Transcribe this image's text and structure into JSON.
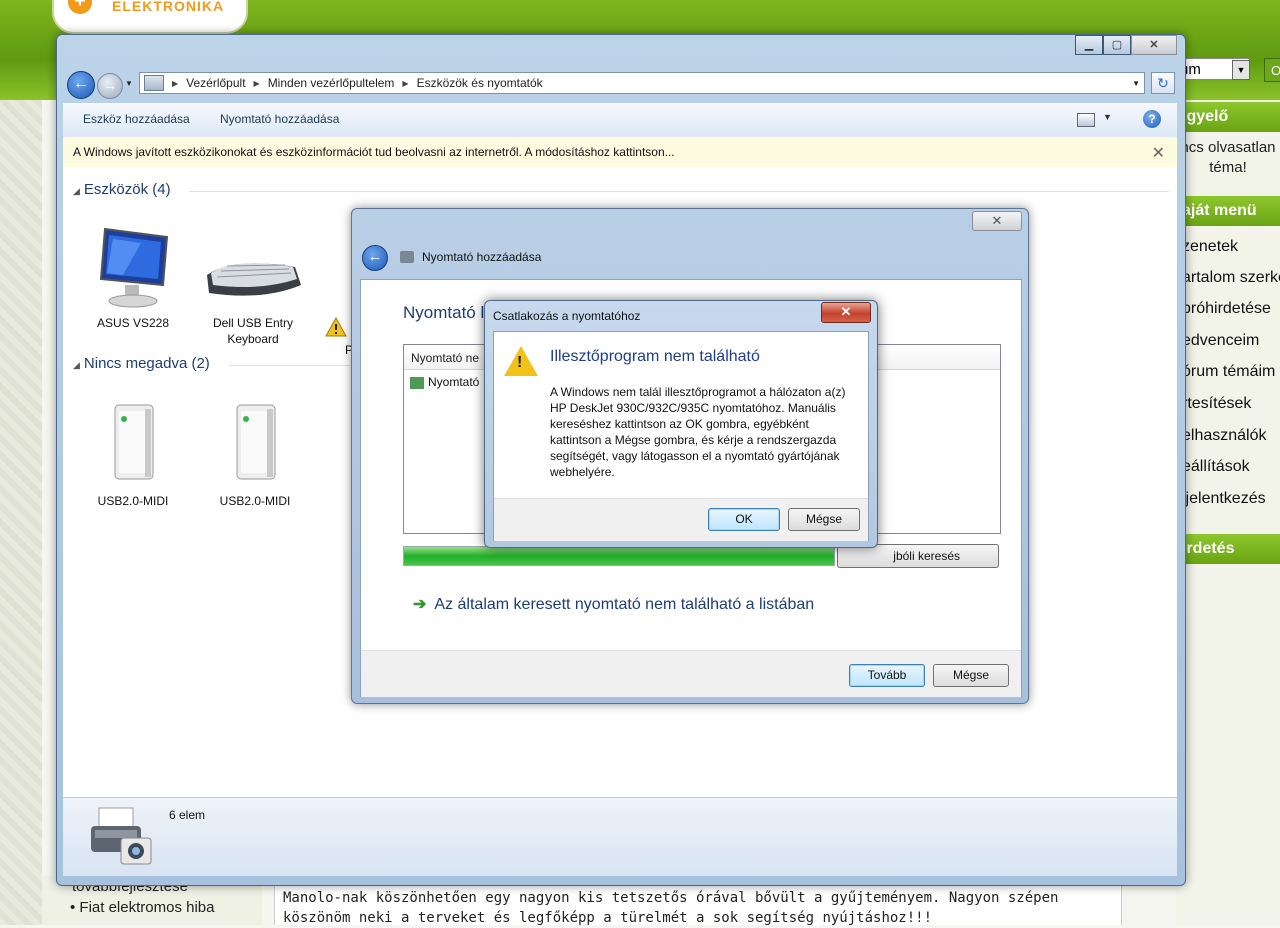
{
  "site": {
    "search_value": "rum",
    "go_label": "O",
    "sidebar": {
      "watch_head": "igyelő",
      "watch_text_1": "ncs olvasatlan",
      "watch_text_2": "téma!",
      "menu_head": "aját menü",
      "menu_items": [
        "zenetek",
        "artalom szerke",
        "próhirdetése",
        "edvenceim",
        "órum témáim",
        "rtesítések",
        "elhasználók",
        "eállítások",
        "ijelentkezés"
      ],
      "ads_head": "irdetés"
    },
    "left_list": {
      "item_1": "továbbfejlesztése",
      "item_2": "• Fiat elektromos hiba"
    },
    "post_text": "Manolo-nak köszönhetően egy nagyon kis tetszetős órával bővült a gyűjteményem. Nagyon szépen\nköszönöm neki a terveket és legfőképp a türelmét a sok segítség nyújtáshoz!!!"
  },
  "explorer": {
    "breadcrumb": [
      "Vezérlőpult",
      "Minden vezérlőpultelem",
      "Eszközök és nyomtatók"
    ],
    "toolbar": {
      "add_device": "Eszköz hozzáadása",
      "add_printer": "Nyomtató hozzáadása"
    },
    "infobar": "A Windows javított eszközikonokat és eszközinformációt tud beolvasni az internetről. A módosításhoz kattintson...",
    "groups": {
      "devices_head": "Eszközök (4)",
      "unspecified_head": "Nincs megadva (2)"
    },
    "devices": [
      {
        "name": "ASUS VS228"
      },
      {
        "name": "Dell USB Entry Keyboard"
      },
      {
        "name": "P"
      }
    ],
    "unspecified": [
      {
        "name": "USB2.0-MIDI"
      },
      {
        "name": "USB2.0-MIDI"
      }
    ],
    "status": "6 elem"
  },
  "wizard": {
    "title": "Nyomtató hozzáadása",
    "heading": "Nyomtató l",
    "list_header": "Nyomtató ne",
    "list_item": "Nyomtató",
    "progress": 1.0,
    "search_again": "jbóli keresés",
    "not_listed_link": "Az általam keresett nyomtató nem található a listában",
    "next": "Tovább",
    "cancel": "Mégse"
  },
  "dialog": {
    "title": "Csatlakozás a nyomtatóhoz",
    "heading": "Illesztőprogram nem található",
    "message": "A Windows nem talál illesztőprogramot a hálózaton a(z) HP DeskJet 930C/932C/935C nyomtatóhoz. Manuális kereséshez kattintson az OK gombra, egyébként kattintson a Mégse gombra, és kérje a rendszergazda segítségét, vagy látogasson el a nyomtató gyártójának webhelyére.",
    "ok": "OK",
    "cancel": "Mégse"
  }
}
